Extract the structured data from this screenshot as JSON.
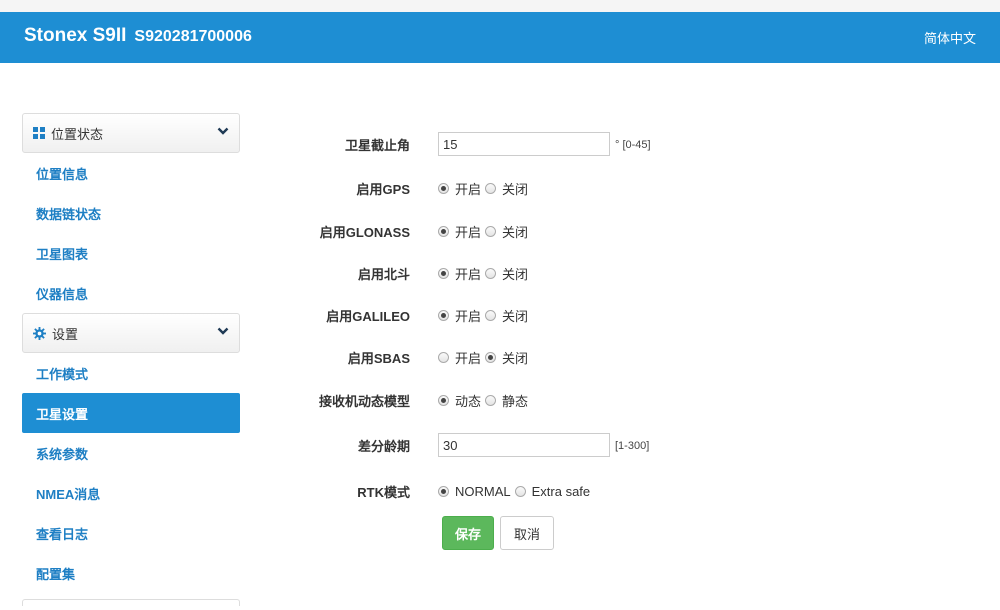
{
  "header": {
    "model": "Stonex S9II",
    "serial": "S920281700006",
    "language": "简体中文"
  },
  "sidebar": {
    "groups": [
      {
        "title": "位置状态",
        "icon": "grid-icon",
        "items": [
          {
            "label": "位置信息",
            "active": false
          },
          {
            "label": "数据链状态",
            "active": false
          },
          {
            "label": "卫星图表",
            "active": false
          },
          {
            "label": "仪器信息",
            "active": false
          }
        ]
      },
      {
        "title": "设置",
        "icon": "gear-icon",
        "items": [
          {
            "label": "工作模式",
            "active": false
          },
          {
            "label": "卫星设置",
            "active": true
          },
          {
            "label": "系统参数",
            "active": false
          },
          {
            "label": "NMEA消息",
            "active": false
          },
          {
            "label": "查看日志",
            "active": false
          },
          {
            "label": "配置集",
            "active": false
          }
        ]
      }
    ]
  },
  "form": {
    "elevation_mask": {
      "label": "卫星截止角",
      "value": "15",
      "hint": "° [0-45]"
    },
    "gps": {
      "label": "启用GPS",
      "options": [
        "开启",
        "关闭"
      ],
      "selected": "开启"
    },
    "glonass": {
      "label": "启用GLONASS",
      "options": [
        "开启",
        "关闭"
      ],
      "selected": "开启"
    },
    "beidou": {
      "label": "启用北斗",
      "options": [
        "开启",
        "关闭"
      ],
      "selected": "开启"
    },
    "galileo": {
      "label": "启用GALILEO",
      "options": [
        "开启",
        "关闭"
      ],
      "selected": "开启"
    },
    "sbas": {
      "label": "启用SBAS",
      "options": [
        "开启",
        "关闭"
      ],
      "selected": "关闭"
    },
    "dynamic_model": {
      "label": "接收机动态模型",
      "options": [
        "动态",
        "静态"
      ],
      "selected": "动态"
    },
    "diff_age": {
      "label": "差分龄期",
      "value": "30",
      "hint": "[1-300]"
    },
    "rtk_mode": {
      "label": "RTK模式",
      "options": [
        "NORMAL",
        "Extra safe"
      ],
      "selected": "NORMAL"
    }
  },
  "buttons": {
    "save": "保存",
    "cancel": "取消"
  },
  "colors": {
    "header": "#1e8ed3",
    "link": "#1e7fc4",
    "save": "#5cb85c"
  }
}
